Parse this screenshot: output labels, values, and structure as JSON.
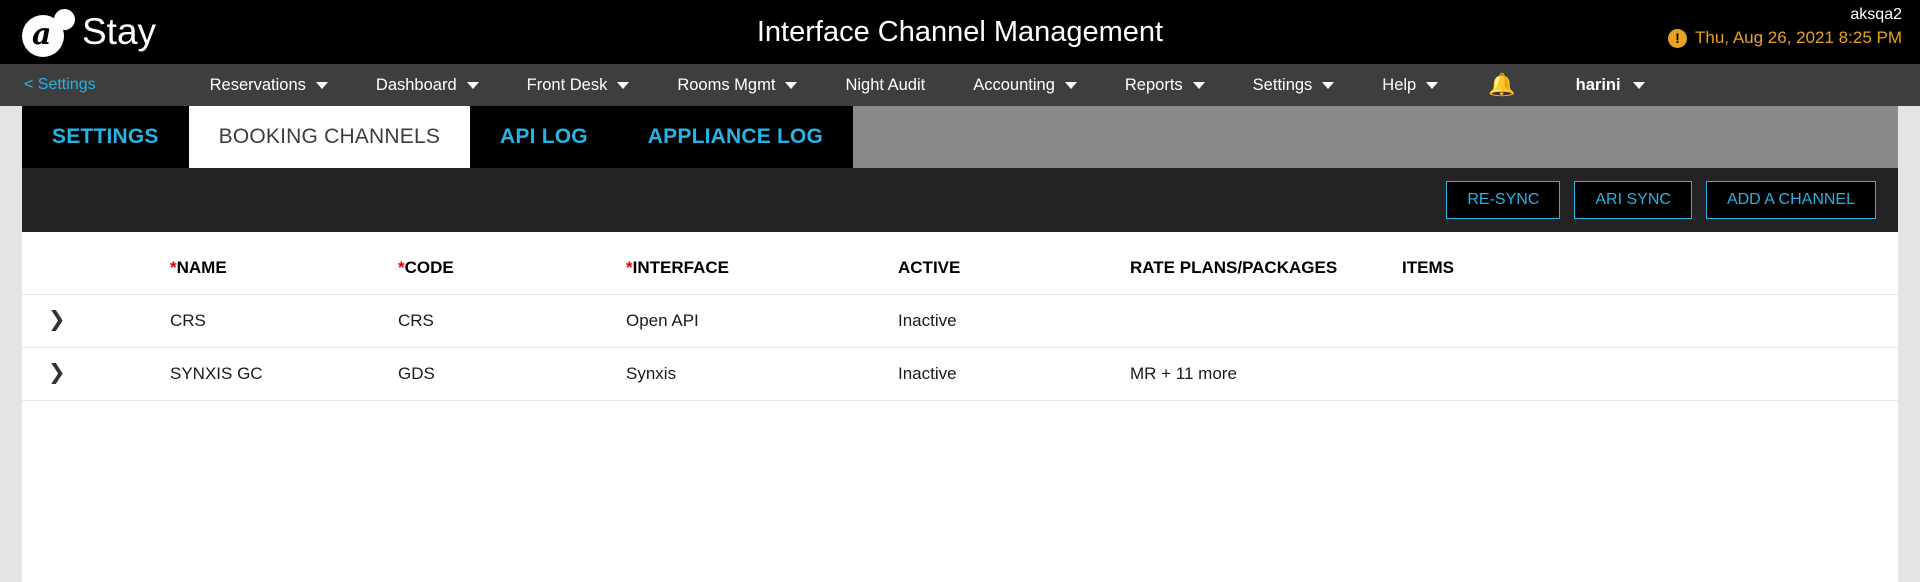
{
  "header": {
    "brand_letter": "a",
    "brand_name": "Stay",
    "title": "Interface Channel Management",
    "user": "aksqa2",
    "warn_icon": "exclamation-icon",
    "datetime": "Thu, Aug 26, 2021 8:25 PM"
  },
  "nav": {
    "back_label": "< Settings",
    "items": [
      {
        "label": "Reservations",
        "caret": true
      },
      {
        "label": "Dashboard",
        "caret": true
      },
      {
        "label": "Front Desk",
        "caret": true
      },
      {
        "label": "Rooms Mgmt",
        "caret": true
      },
      {
        "label": "Night Audit",
        "caret": false
      },
      {
        "label": "Accounting",
        "caret": true
      },
      {
        "label": "Reports",
        "caret": true
      },
      {
        "label": "Settings",
        "caret": true
      },
      {
        "label": "Help",
        "caret": true
      }
    ],
    "bell_icon": "notification-bell-icon",
    "user_label": "harini"
  },
  "tabs": [
    {
      "label": "SETTINGS",
      "active": false
    },
    {
      "label": "BOOKING CHANNELS",
      "active": true
    },
    {
      "label": "API LOG",
      "active": false
    },
    {
      "label": "APPLIANCE LOG",
      "active": false
    }
  ],
  "actions": [
    {
      "label": "RE-SYNC"
    },
    {
      "label": "ARI SYNC"
    },
    {
      "label": "ADD A CHANNEL"
    }
  ],
  "table": {
    "columns": [
      {
        "label": "NAME",
        "required": true
      },
      {
        "label": "CODE",
        "required": true
      },
      {
        "label": "INTERFACE",
        "required": true
      },
      {
        "label": "ACTIVE",
        "required": false
      },
      {
        "label": "RATE PLANS/PACKAGES",
        "required": false
      },
      {
        "label": "ITEMS",
        "required": false
      }
    ],
    "rows": [
      {
        "expand_icon": "chevron-right-icon",
        "name": "CRS",
        "code": "CRS",
        "interface": "Open API",
        "active": "Inactive",
        "rate_plans": "",
        "items": ""
      },
      {
        "expand_icon": "chevron-right-icon",
        "name": "SYNXIS GC",
        "code": "GDS",
        "interface": "Synxis",
        "active": "Inactive",
        "rate_plans": "MR + 11 more",
        "items": ""
      }
    ]
  },
  "colors": {
    "accent_cyan": "#27b3e4",
    "warn_orange": "#e8a222",
    "required_red": "#e00000",
    "header_black": "#000000",
    "nav_gray": "#3e3e3e"
  }
}
